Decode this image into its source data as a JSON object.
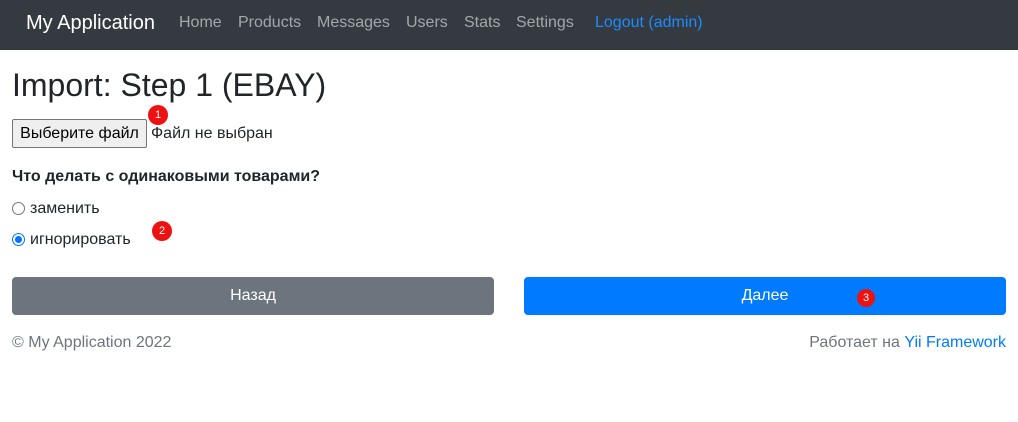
{
  "navbar": {
    "brand": "My Application",
    "items": [
      {
        "label": "Home"
      },
      {
        "label": "Products"
      },
      {
        "label": "Messages"
      },
      {
        "label": "Users"
      },
      {
        "label": "Stats"
      },
      {
        "label": "Settings"
      }
    ],
    "logout": "Logout (admin)"
  },
  "page": {
    "title": "Import: Step 1 (EBAY)"
  },
  "file_input": {
    "button_label": "Выберите файл",
    "status": "Файл не выбран"
  },
  "duplicates": {
    "question": "Что делать с одинаковыми товарами?",
    "options": [
      {
        "label": "заменить",
        "checked": false
      },
      {
        "label": "игнорировать",
        "checked": true
      }
    ]
  },
  "actions": {
    "back_label": "Назад",
    "next_label": "Далее"
  },
  "markers": [
    "1",
    "2",
    "3"
  ],
  "footer": {
    "copyright": "© My Application 2022",
    "powered_prefix": "Работает на ",
    "powered_link": "Yii Framework"
  },
  "colors": {
    "navbar_bg": "#343a40",
    "primary": "#007bff",
    "secondary": "#6c757d",
    "marker": "#ee1111"
  }
}
